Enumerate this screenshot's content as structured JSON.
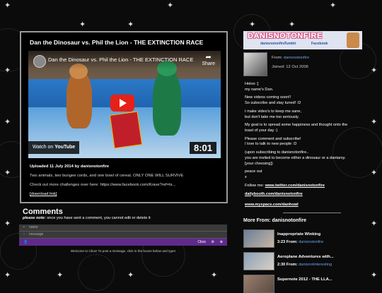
{
  "video": {
    "title": "Dan the Dinosaur vs. Phil the Lion - THE EXTINCTION RACE",
    "player_title": "Dan the Dinosaur vs. Phil the Lion - THE EXTINCTION RACE",
    "share_label": "Share",
    "watch_on_label": "Watch on",
    "watch_on_brand": "YouTube",
    "duration": "8:01",
    "uploaded": "Uploaded 11 July 2014 by danisnotonfire",
    "description": "Two animals, two bungee cords, and one bowl of cereal. ONLY ONE WILL SURVIVE",
    "more_challenges": "Check out more challenges over here: https://www.facebook.com/Krave?ref=ts...",
    "download_link": "[download link]"
  },
  "comments": {
    "heading": "Comments",
    "note_label": "please note:",
    "note_text": " once you have sent a comment, you cannot edit or delete it",
    "name_placeholder": "name",
    "message_placeholder": "message",
    "cbox_label": "Cbox",
    "welcome": "Welcome to Cbox! To post a message, click in the boxes below and type!"
  },
  "profile": {
    "banner_title": "DANISNOTONFIRE",
    "banner_subs": [
      "danisnotonfire",
      "Tumblr",
      "Facebook"
    ],
    "from_label": "From:",
    "from_value": "danisnotonfire",
    "joined": "Joined: 12 Oct 2006",
    "bio": [
      "Heloo :]\nmy name's Dan.",
      "New videos coming soon!!\nSo subscribe and stay tuned! :D",
      "I make video's to keep me sane,\nbut don't take me too seriously.",
      "My goal is to spread some happiness and thought onto the\ntoast of your day :)",
      "Please comment and subscribe!\nI love to talk to new people :D",
      "(upon subscribing to danisnotonfire..\nyou are invited to become either a dinosaur or a dantarsy.\n[your choosing])",
      "peace out\nx"
    ],
    "follow_label": "Follow me: ",
    "twitter": "www.twitter.com/danisnotonfire",
    "dailybooth": "dailybooth.com/danisnotonfire",
    "myspace": "www.myspace.com/danhowl"
  },
  "more_from": {
    "heading": "More From: danisnotonfire",
    "items": [
      {
        "title": "Inappropriate Winking",
        "time": "3:23",
        "from_label": "From:",
        "channel": "danisnotonfire"
      },
      {
        "title": "Aeroplane Adventures with...",
        "time": "2:30",
        "from_label": "From:",
        "channel": "danisnotinteresting"
      },
      {
        "title": "Supernote 2012 - THE LLA...",
        "time": "",
        "from_label": "",
        "channel": ""
      }
    ]
  },
  "colors": {
    "background": "#0b0b0b",
    "cbox_bar": "#5f2a8c",
    "link": "#6aa4e8",
    "youtube_red": "#e62117"
  },
  "icons": [
    "butterfly-icon",
    "play-icon",
    "share-icon",
    "user-icon",
    "message-icon",
    "gear-icon",
    "close-icon"
  ]
}
